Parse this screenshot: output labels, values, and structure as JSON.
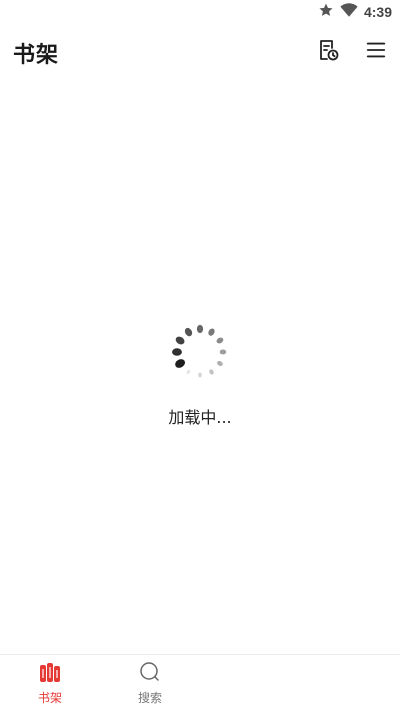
{
  "status_bar": {
    "time": "4:39",
    "icons": [
      "star-icon",
      "wifi-icon"
    ]
  },
  "header": {
    "title": "书架",
    "actions": [
      "reading-history-icon",
      "menu-icon"
    ]
  },
  "main": {
    "loading_text": "加载中..."
  },
  "bottom_nav": {
    "items": [
      {
        "label": "书架",
        "icon": "bookshelf-icon",
        "active": true
      },
      {
        "label": "搜索",
        "icon": "search-icon",
        "active": false
      }
    ]
  },
  "colors": {
    "accent": "#e53935",
    "text": "#222222",
    "inactive": "#777777",
    "background": "#ffffff"
  }
}
